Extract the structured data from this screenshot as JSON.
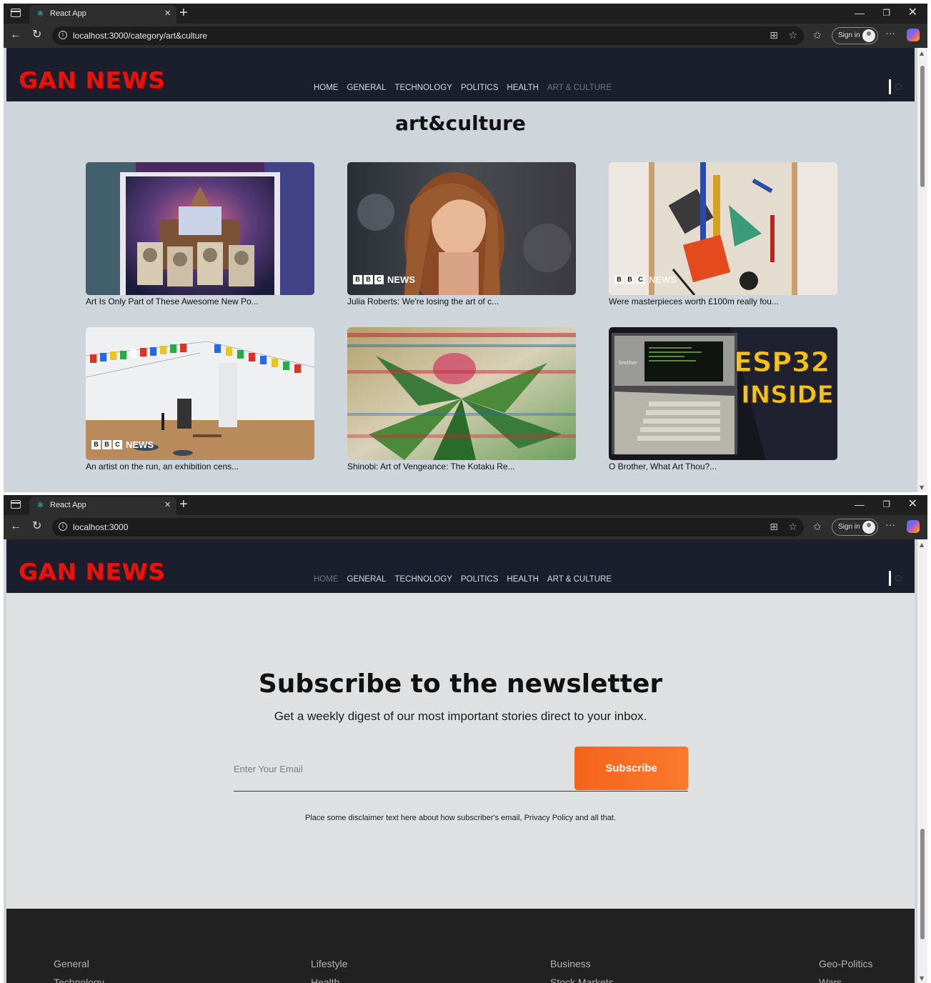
{
  "colors": {
    "header_bg": "#1b1e2c",
    "logo_red": "#e2150f",
    "page_bg": "#cfd6db",
    "newsletter_bg": "#dfe0e1",
    "subscribe_orange": "#f5621c",
    "footer_bg": "#212121"
  },
  "browser": {
    "tab_title": "React App",
    "favicon": "react-icon",
    "signin_label": "Sign in"
  },
  "win1": {
    "url": "localhost:3000/category/art&culture"
  },
  "win2": {
    "url": "localhost:3000"
  },
  "site": {
    "logo": "GAN NEWS",
    "nav": [
      "HOME",
      "GENERAL",
      "TECHNOLOGY",
      "POLITICS",
      "HEALTH",
      "ART & CULTURE"
    ],
    "win1_active_nav": "ART & CULTURE",
    "win2_active_nav": "HOME"
  },
  "category": {
    "title": "art&culture",
    "bbc_news_label": "NEWS",
    "articles": [
      {
        "caption": "Art Is Only Part of These Awesome New Po...",
        "image": "ghostbusters-art"
      },
      {
        "caption": "Julia Roberts: We're losing the art of c...",
        "image": "portrait-photo",
        "bbc_badge": true
      },
      {
        "caption": "Were masterpieces worth £100m really fou...",
        "image": "abstract-painting",
        "bbc_badge": true
      },
      {
        "caption": "An artist on the run, an exhibition cens...",
        "image": "gallery-flags",
        "bbc_badge": true
      },
      {
        "caption": "Shinobi: Art of Vengeance: The Kotaku Re...",
        "image": "glitch-art"
      },
      {
        "caption": "O Brother, What Art Thou?...",
        "image": "esp32-laptop",
        "image_text": [
          "ESP32",
          "INSIDE"
        ],
        "device_label": "brother"
      }
    ]
  },
  "newsletter": {
    "title": "Subscribe to the newsletter",
    "subtitle": "Get a weekly digest of our most important stories direct to your inbox.",
    "email_placeholder": "Enter Your Email",
    "button_label": "Subscribe",
    "disclaimer": "Place some disclaimer text here about how subscriber's email, Privacy Policy and all that."
  },
  "footer": {
    "columns": [
      [
        "General",
        "Technology"
      ],
      [
        "Lifestyle",
        "Health"
      ],
      [
        "Business",
        "Stock Markets"
      ],
      [
        "Geo-Politics",
        "Wars"
      ]
    ]
  }
}
